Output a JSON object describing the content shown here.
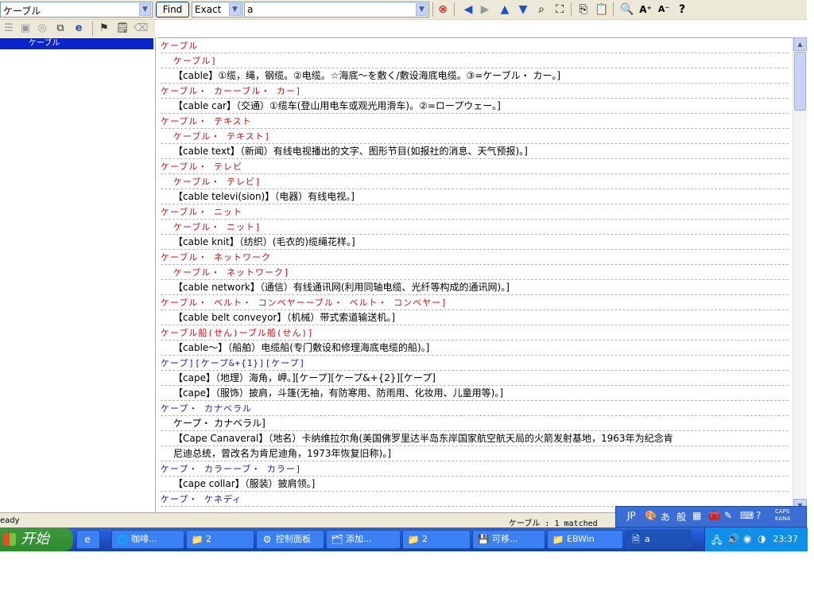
{
  "toolbar": {
    "search_word": "ケーブル",
    "find_label": "Find",
    "match_mode": "Exact",
    "dictionary": "a"
  },
  "left_pane": {
    "selected_item": "ケーブル"
  },
  "entries": [
    {
      "cls": "red",
      "text": "ケーブル",
      "indent": false
    },
    {
      "cls": "red",
      "text": "ケーブル]",
      "indent": true
    },
    {
      "cls": "",
      "text": "【cable】①缆，绳，钢缆。②电缆。☆海底～を敷く/敷设海底电缆。③=ケーブル・ カー。]",
      "indent": true
    },
    {
      "cls": "red",
      "text": "ケーブル・ カーーブル・ カー]",
      "indent": false
    },
    {
      "cls": "",
      "text": "【cable car】（交通）①缆车(登山用电车或观光用滑车)。②=ロープウェー。]",
      "indent": true
    },
    {
      "cls": "red",
      "text": "ケーブル・ テキスト",
      "indent": false
    },
    {
      "cls": "red",
      "text": "ケーブル・ テキスト]",
      "indent": true
    },
    {
      "cls": "",
      "text": "【cable text】（新闻）有线电视播出的文字、图形节目(如报社的消息、天气预报)。]",
      "indent": true
    },
    {
      "cls": "red",
      "text": "ケーブル・ テレビ",
      "indent": false
    },
    {
      "cls": "red",
      "text": "ケーブル・ テレビ]",
      "indent": true
    },
    {
      "cls": "",
      "text": "【cable televi(sion)】（电器）有线电视。]",
      "indent": true
    },
    {
      "cls": "red",
      "text": "ケーブル・ ニット",
      "indent": false
    },
    {
      "cls": "red",
      "text": "ケーブル・ ニット]",
      "indent": true
    },
    {
      "cls": "",
      "text": "【cable knit】（纺织）(毛衣的)缆绳花样。]",
      "indent": true
    },
    {
      "cls": "red",
      "text": "ケーブル・ ネットワーク",
      "indent": false
    },
    {
      "cls": "red",
      "text": "ケーブル・ ネットワーク]",
      "indent": true
    },
    {
      "cls": "",
      "text": "【cable network】（通信）有线通讯网(利用同轴电缆、光纤等构成的通讯网)。]",
      "indent": true
    },
    {
      "cls": "red",
      "text": "ケーブル・ ベルト・ コンベヤーーブル・ ベルト・ コンベヤー]",
      "indent": false
    },
    {
      "cls": "",
      "text": "【cable belt conveyor】（机械）带式索道输送机。]",
      "indent": true
    },
    {
      "cls": "red",
      "text": "ケーブル船(せん)ーブル船(せん)]",
      "indent": false
    },
    {
      "cls": "",
      "text": "【cable～】（船舶）电缆船(专门敷设和修理海底电缆的船)。]",
      "indent": true
    },
    {
      "cls": "blue",
      "text": "ケープ][ケープ&+{1}][ケープ]",
      "indent": false
    },
    {
      "cls": "",
      "text": "【cape】（地理）海角，岬。][ケープ][ケープ&+{2}][ケープ]",
      "indent": true
    },
    {
      "cls": "",
      "text": "【cape】（服饰）披肩，斗篷(无袖，有防寒用、防雨用、化妆用、儿童用等)。]",
      "indent": true
    },
    {
      "cls": "blue",
      "text": "ケープ・ カナベラル",
      "indent": false
    },
    {
      "cls": "",
      "text": "ケープ・ カナベラル]",
      "indent": true
    },
    {
      "cls": "",
      "text": "【Cape Canaveral】（地名）卡纳维拉尔角(美国佛罗里达半岛东岸国家航空航天局的火箭发射基地，1963年为纪念肯",
      "indent": true
    },
    {
      "cls": "",
      "text": "尼迪总统，曾改名为肯尼迪角，1973年恢复旧称)。]",
      "indent": true
    },
    {
      "cls": "blue",
      "text": "ケープ・ カラーーブ・ カラー]",
      "indent": false
    },
    {
      "cls": "",
      "text": "【cape collar】（服装）披肩领。]",
      "indent": true
    },
    {
      "cls": "blue",
      "text": "ケープ・ ケネディ",
      "indent": false
    }
  ],
  "status": {
    "left": "eady",
    "right": "ケーブル : 1 matched"
  },
  "langbar": {
    "lang": "JP",
    "caps": "CAPS",
    "kana": "KANA"
  },
  "taskbar": {
    "start_label": "开始",
    "tasks": [
      "咖啡...",
      "2",
      "控制面板",
      "添加...",
      "2",
      "可移...",
      "EBWin",
      "a"
    ],
    "clock": "23:37"
  },
  "colors": {
    "headword_red": "#d01010",
    "headword_blue": "#1a1ab8",
    "selection": "#0a24cc"
  }
}
